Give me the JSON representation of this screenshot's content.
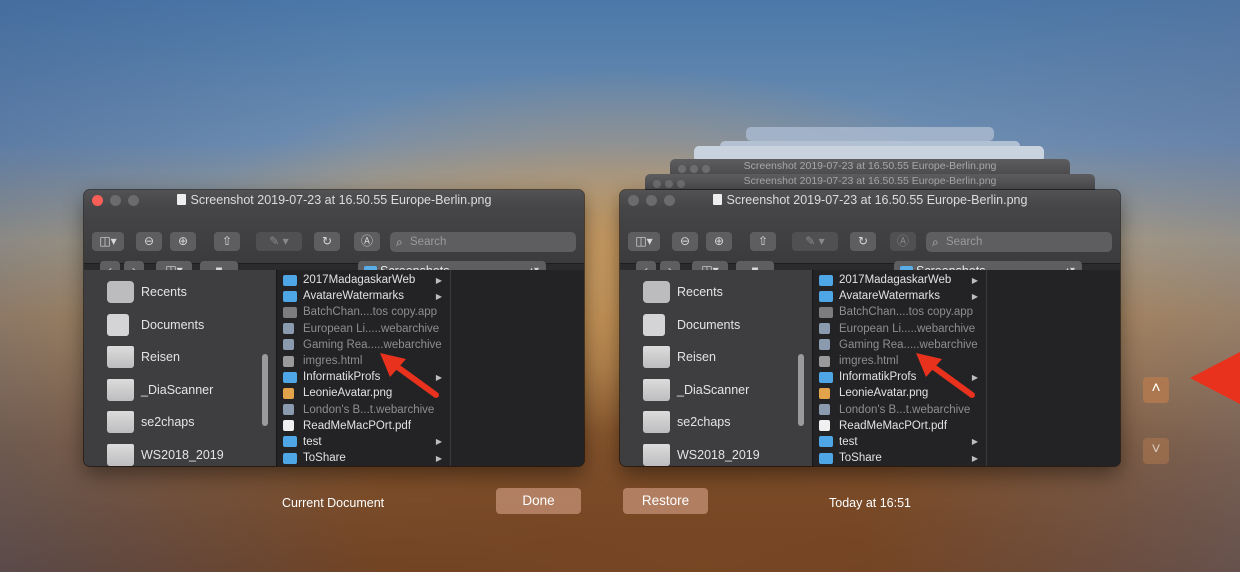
{
  "ghost_titles": [
    "Screenshot 2019-07-23 at 16.50.55 Europe-Berlin.png",
    "Screenshot 2019-07-23 at 16.50.55 Europe-Berlin.png"
  ],
  "window": {
    "title": "Screenshot 2019-07-23 at 16.50.55 Europe-Berlin.png",
    "search_placeholder": "Search",
    "location": "Screenshots",
    "sidebar": [
      "Recents",
      "Documents",
      "Reisen",
      "_DiaScanner",
      "se2chaps",
      "WS2018_2019"
    ],
    "files": [
      {
        "name": "2017MadagaskarWeb",
        "kind": "folder",
        "dim": false,
        "arrow": true
      },
      {
        "name": "AvatareWatermarks",
        "kind": "folder",
        "dim": false,
        "arrow": true
      },
      {
        "name": "BatchChan....tos copy.app",
        "kind": "app",
        "dim": true,
        "arrow": false
      },
      {
        "name": "European Li.....webarchive",
        "kind": "web",
        "dim": true,
        "arrow": false
      },
      {
        "name": "Gaming Rea.....webarchive",
        "kind": "web",
        "dim": true,
        "arrow": false
      },
      {
        "name": "imgres.html",
        "kind": "html",
        "dim": true,
        "arrow": false
      },
      {
        "name": "InformatikProfs",
        "kind": "folder",
        "dim": false,
        "arrow": true
      },
      {
        "name": "LeonieAvatar.png",
        "kind": "png",
        "dim": false,
        "arrow": false
      },
      {
        "name": "London's B...t.webarchive",
        "kind": "web",
        "dim": true,
        "arrow": false
      },
      {
        "name": "ReadMeMacPOrt.pdf",
        "kind": "pdf",
        "dim": false,
        "arrow": false
      },
      {
        "name": "test",
        "kind": "folder",
        "dim": false,
        "arrow": true
      },
      {
        "name": "ToShare",
        "kind": "folder",
        "dim": false,
        "arrow": true
      }
    ]
  },
  "footer": {
    "current_label": "Current Document",
    "done_label": "Done",
    "restore_label": "Restore",
    "timestamp": "Today at 16:51"
  },
  "icons": {
    "up": "˄",
    "down": "˅",
    "chevron_updown": "▴▾",
    "disclosure": "▶"
  },
  "colors": {
    "accent_arrow": "#e8321e",
    "folder_blue": "#4ea6e6",
    "close_red": "#fc5f57"
  }
}
